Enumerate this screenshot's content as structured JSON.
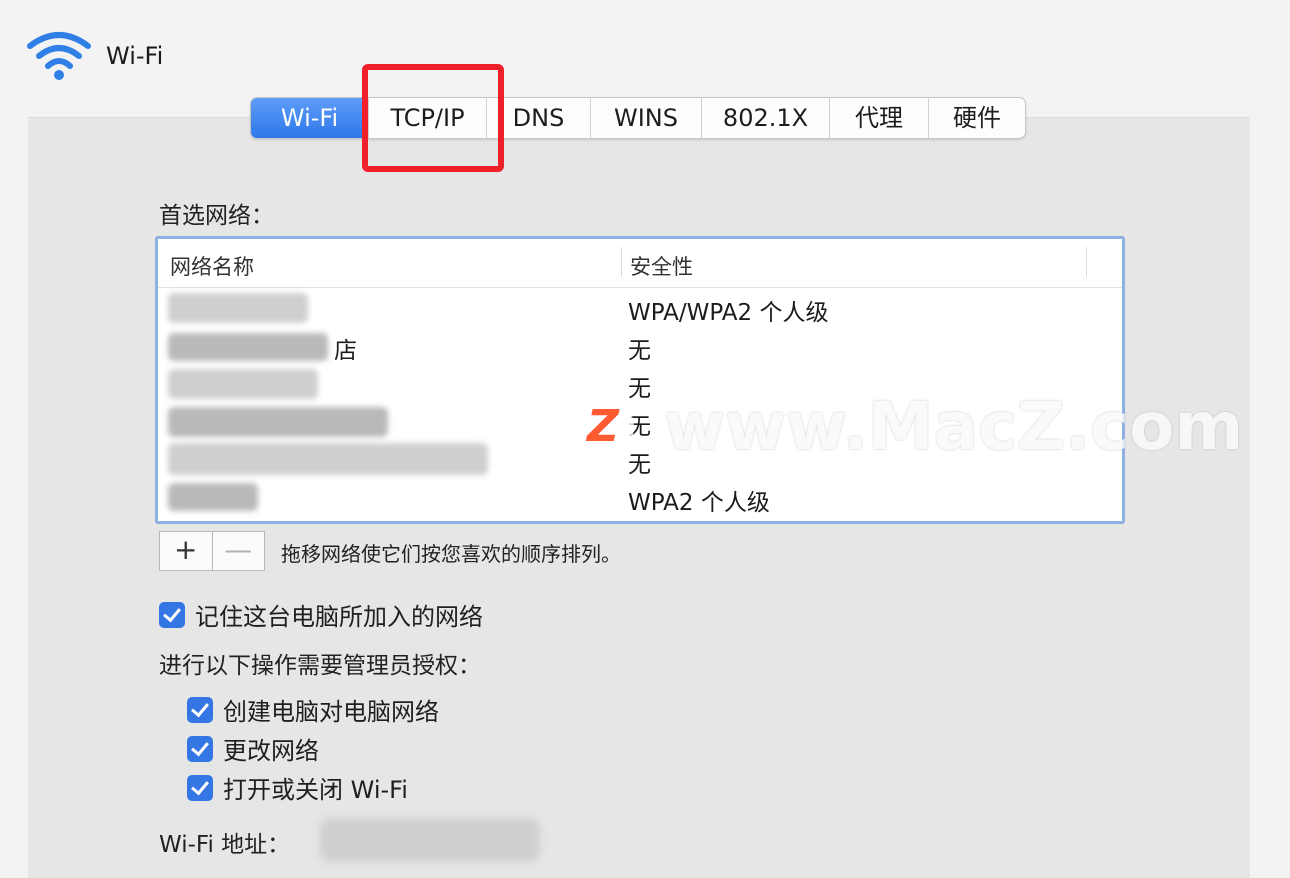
{
  "window": {
    "title": "Wi-Fi"
  },
  "tabs": [
    {
      "label": "Wi-Fi",
      "active": true
    },
    {
      "label": "TCP/IP",
      "active": false
    },
    {
      "label": "DNS",
      "active": false
    },
    {
      "label": "WINS",
      "active": false
    },
    {
      "label": "802.1X",
      "active": false
    },
    {
      "label": "代理",
      "active": false
    },
    {
      "label": "硬件",
      "active": false
    }
  ],
  "preferred": {
    "label": "首选网络：",
    "columns": [
      "网络名称",
      "安全性"
    ],
    "rows": [
      {
        "name": "",
        "security": "WPA/WPA2 个人级"
      },
      {
        "name": "店",
        "security": "无"
      },
      {
        "name": "",
        "security": "无"
      },
      {
        "name": "",
        "security": "无"
      },
      {
        "name": "",
        "security": "无"
      },
      {
        "name": "",
        "security": "WPA2 个人级"
      }
    ]
  },
  "controls": {
    "add_label": "+",
    "remove_label": "—",
    "hint": "拖移网络使它们按您喜欢的顺序排列。"
  },
  "remember": {
    "label": "记住这台电脑所加入的网络",
    "checked": true
  },
  "admin": {
    "label": "进行以下操作需要管理员授权：",
    "options": [
      {
        "label": "创建电脑对电脑网络",
        "checked": true
      },
      {
        "label": "更改网络",
        "checked": true
      },
      {
        "label": "打开或关闭 Wi-Fi",
        "checked": true
      }
    ]
  },
  "address": {
    "label": "Wi-Fi 地址："
  },
  "watermark": {
    "logo": "Z",
    "text": "www.MacZ.com"
  },
  "colors": {
    "accent": "#3476e4",
    "highlight": "#f0202a",
    "table_border": "#8fb0e2"
  }
}
